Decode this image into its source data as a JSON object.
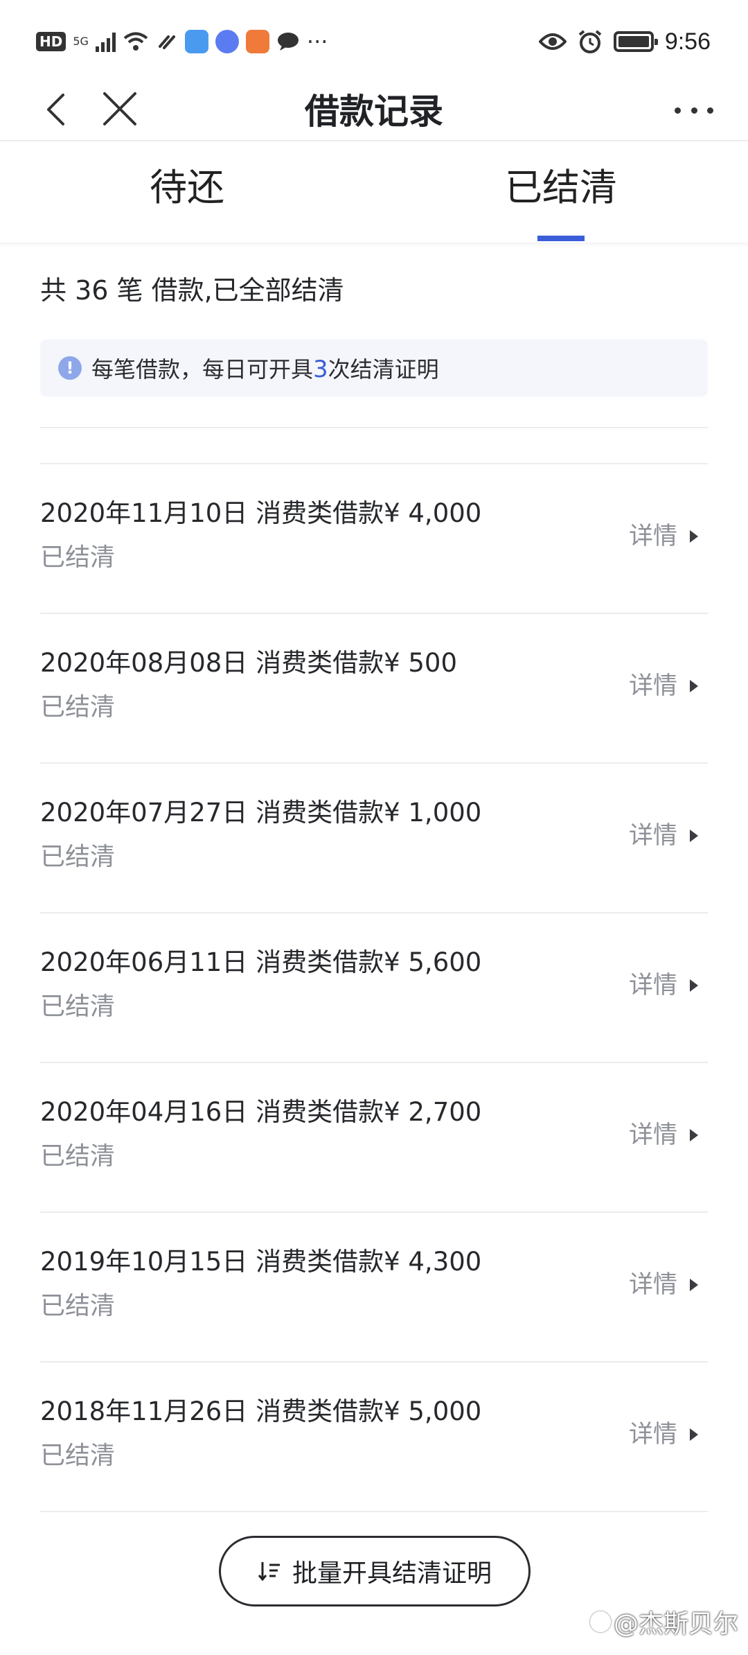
{
  "status_bar": {
    "hd": "HD",
    "network": "5G",
    "more_indicator": "···",
    "time": "9:56",
    "icons": [
      "signal-icon",
      "wifi-icon",
      "link-icon",
      "paper-plane-app-icon",
      "music-app-icon",
      "game-app-icon",
      "chat-bubble-icon",
      "eye-icon",
      "alarm-icon",
      "battery-icon"
    ]
  },
  "nav": {
    "title": "借款记录"
  },
  "tabs": [
    {
      "label": "待还",
      "active": false
    },
    {
      "label": "已结清",
      "active": true
    }
  ],
  "summary": "共 36 笔 借款,已全部结清",
  "notice": {
    "text_before": "每笔借款，每日可开具",
    "highlight": "3",
    "text_after": "次结清证明"
  },
  "loans": [
    {
      "title": "2020年11月10日 消费类借款¥ 4,000",
      "status": "已结清",
      "detail": "详情"
    },
    {
      "title": "2020年08月08日 消费类借款¥ 500",
      "status": "已结清",
      "detail": "详情"
    },
    {
      "title": "2020年07月27日 消费类借款¥ 1,000",
      "status": "已结清",
      "detail": "详情"
    },
    {
      "title": "2020年06月11日 消费类借款¥ 5,600",
      "status": "已结清",
      "detail": "详情"
    },
    {
      "title": "2020年04月16日 消费类借款¥ 2,700",
      "status": "已结清",
      "detail": "详情"
    },
    {
      "title": "2019年10月15日 消费类借款¥ 4,300",
      "status": "已结清",
      "detail": "详情"
    },
    {
      "title": "2018年11月26日 消费类借款¥ 5,000",
      "status": "已结清",
      "detail": "详情"
    }
  ],
  "batch_button": "批量开具结清证明",
  "watermark": "@杰斯贝尔",
  "colors": {
    "accent": "#3a5dd9",
    "muted_text": "#8d9097",
    "notice_bg": "#f4f6fb"
  }
}
